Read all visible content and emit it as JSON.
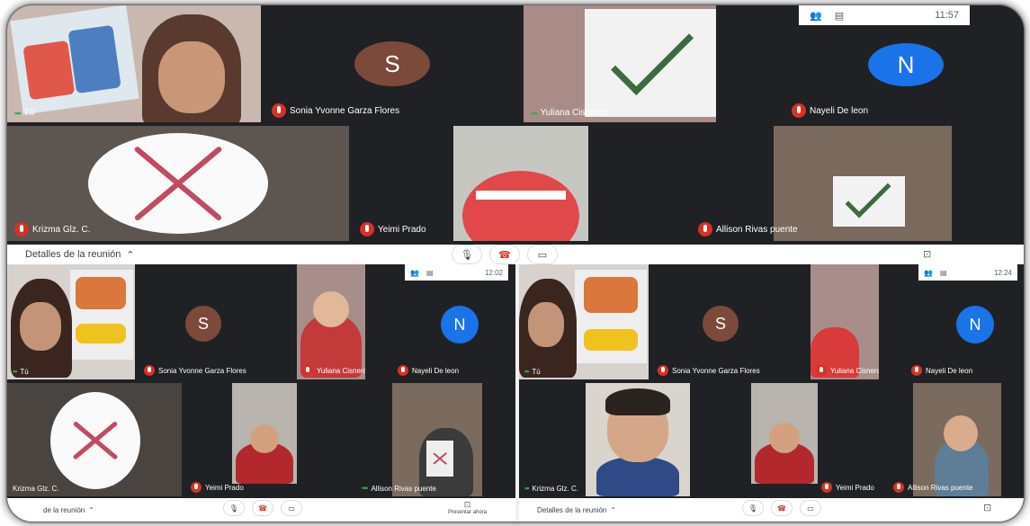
{
  "screenshots": {
    "top": {
      "clock": "11:57",
      "tiles": [
        {
          "name": "Tú",
          "kind": "video"
        },
        {
          "name": "Sonia Yvonne Garza Flores",
          "avatar": "S",
          "avatar_color": "#7b4a3a"
        },
        {
          "name": "Yuliana Cisneros",
          "kind": "video"
        },
        {
          "name": "Nayeli De leon",
          "avatar": "N",
          "avatar_color": "#1a73e8"
        },
        {
          "name": "Krizma Glz. C.",
          "kind": "video"
        },
        {
          "name": "Yeimi Prado",
          "kind": "video"
        },
        {
          "name": "Allison Rivas puente",
          "kind": "video"
        }
      ],
      "meeting_details": "Detalles de la reunión"
    },
    "bottom_left": {
      "clock": "12:02",
      "tiles": [
        {
          "name": "Tú"
        },
        {
          "name": "Sonia Yvonne Garza Flores",
          "avatar": "S"
        },
        {
          "name": "Yuliana Cisneros"
        },
        {
          "name": "Nayeli De leon",
          "avatar": "N"
        },
        {
          "name": "Krizma Glz. C."
        },
        {
          "name": "Yeimi Prado"
        },
        {
          "name": "Allison Rivas puente"
        }
      ],
      "meeting_details": "de la reunión",
      "present_label": "Presentar ahora"
    },
    "bottom_right": {
      "clock": "12:24",
      "tiles": [
        {
          "name": "Tú"
        },
        {
          "name": "Sonia Yvonne Garza Flores",
          "avatar": "S"
        },
        {
          "name": "Yuliana Cisneros"
        },
        {
          "name": "Nayeli De leon",
          "avatar": "N"
        },
        {
          "name": "Krizma Glz. C."
        },
        {
          "name": "Yeimi Prado"
        },
        {
          "name": "Allison Rivas puente"
        }
      ],
      "meeting_details": "Detalles de la reunión"
    }
  },
  "colors": {
    "tile_dark": "#202124",
    "mic_muted": "#d93025",
    "avatar_s": "#7b4a3a",
    "avatar_n": "#1a73e8",
    "x_mark": "#c24a63"
  }
}
